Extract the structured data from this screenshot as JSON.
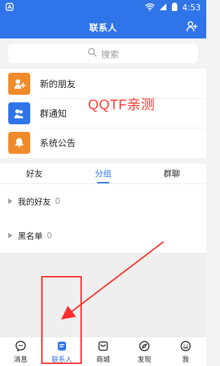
{
  "status_bar": {
    "time": "4:53",
    "left_icon_name": "app-badge-icon",
    "right_icons": [
      "wifi-icon",
      "signal-icon",
      "battery-icon"
    ]
  },
  "header": {
    "title": "联系人",
    "action_icon_name": "add-user-icon"
  },
  "search": {
    "placeholder": "搜索",
    "icon_name": "search-icon"
  },
  "quick_list": [
    {
      "label": "新的朋友",
      "icon": "new-friend-icon",
      "color": "#f08a2a"
    },
    {
      "label": "群通知",
      "icon": "group-notice-icon",
      "color": "#2f74e9"
    },
    {
      "label": "系统公告",
      "icon": "bell-icon",
      "color": "#f08a2a"
    }
  ],
  "watermark": "QQTF亲测",
  "tabs": {
    "items": [
      {
        "label": "好友",
        "active": false
      },
      {
        "label": "分组",
        "active": true
      },
      {
        "label": "群聊",
        "active": false
      }
    ]
  },
  "groups": [
    {
      "name": "我的好友",
      "count": "0"
    },
    {
      "name": "黑名单",
      "count": "0"
    }
  ],
  "bottom_nav": [
    {
      "label": "消息",
      "icon": "message-icon",
      "active": false
    },
    {
      "label": "联系人",
      "icon": "contacts-icon",
      "active": true
    },
    {
      "label": "商城",
      "icon": "shop-icon",
      "active": false
    },
    {
      "label": "发现",
      "icon": "compass-icon",
      "active": false
    },
    {
      "label": "我",
      "icon": "smile-icon",
      "active": false
    }
  ],
  "colors": {
    "primary": "#2f74e9",
    "orange": "#f08a2a",
    "annotation_red": "#ff2c2c"
  }
}
